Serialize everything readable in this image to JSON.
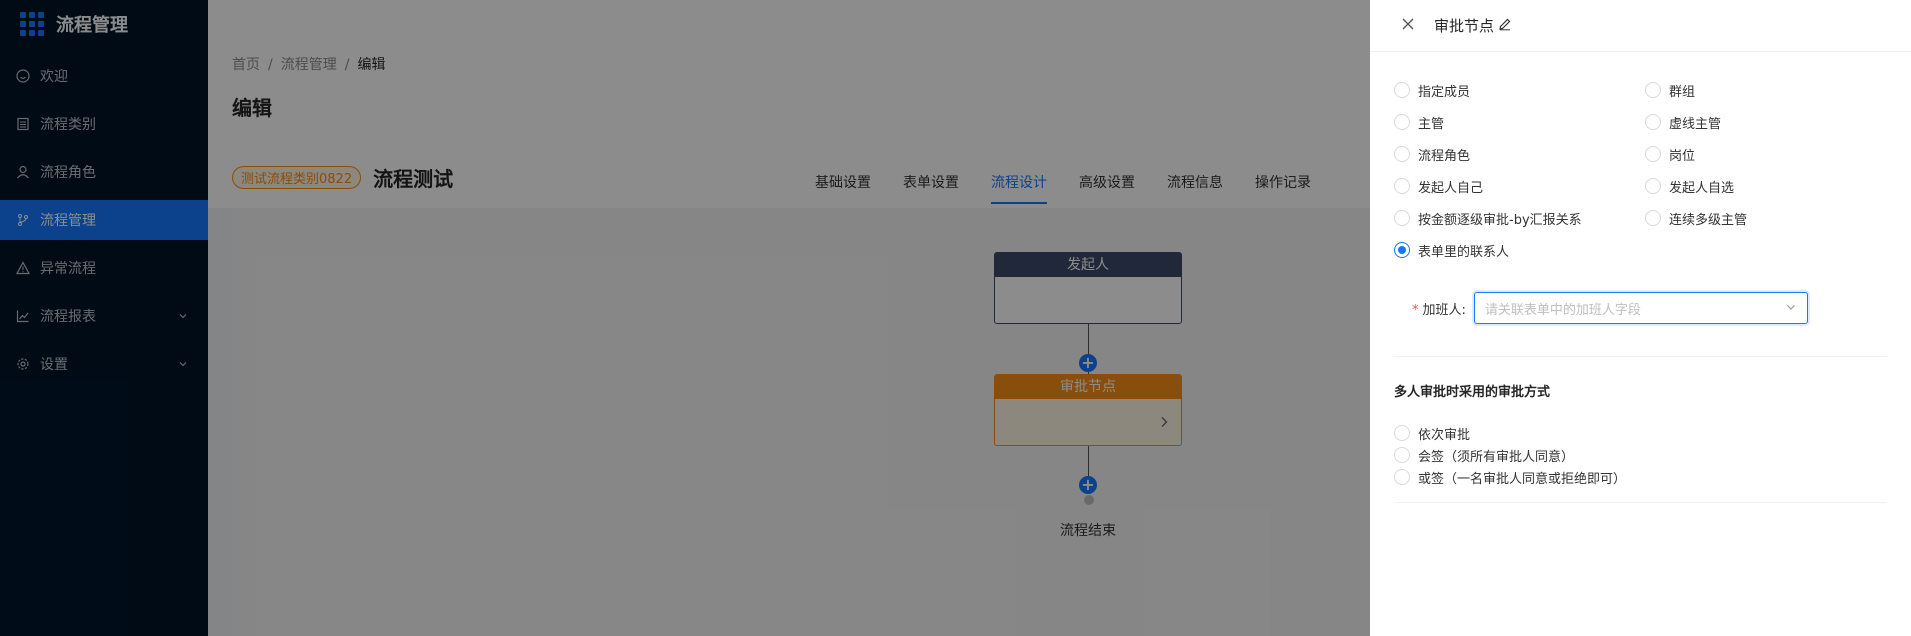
{
  "sidebar": {
    "title": "流程管理",
    "items": [
      {
        "label": "欢迎",
        "icon": "smile-icon",
        "active": false
      },
      {
        "label": "流程类别",
        "icon": "list-icon",
        "active": false
      },
      {
        "label": "流程角色",
        "icon": "user-icon",
        "active": false
      },
      {
        "label": "流程管理",
        "icon": "branch-icon",
        "active": true
      },
      {
        "label": "异常流程",
        "icon": "warning-icon",
        "active": false
      },
      {
        "label": "流程报表",
        "icon": "chart-icon",
        "active": false,
        "expandable": true
      },
      {
        "label": "设置",
        "icon": "gear-icon",
        "active": false,
        "expandable": true
      }
    ]
  },
  "header": {
    "breadcrumb": [
      "首页",
      "流程管理",
      "编辑"
    ],
    "title": "编辑"
  },
  "flow": {
    "category_tag": "测试流程类别0822",
    "name": "流程测试",
    "tabs": [
      {
        "label": "基础设置",
        "active": false
      },
      {
        "label": "表单设置",
        "active": false
      },
      {
        "label": "流程设计",
        "active": true
      },
      {
        "label": "高级设置",
        "active": false
      },
      {
        "label": "流程信息",
        "active": false
      },
      {
        "label": "操作记录",
        "active": false
      }
    ],
    "nodes": {
      "start_label": "发起人",
      "approve_label": "审批节点",
      "end_label": "流程结束"
    }
  },
  "drawer": {
    "title": "审批节点",
    "approver_types": [
      {
        "label": "指定成员",
        "checked": false
      },
      {
        "label": "群组",
        "checked": false
      },
      {
        "label": "主管",
        "checked": false
      },
      {
        "label": "虚线主管",
        "checked": false
      },
      {
        "label": "流程角色",
        "checked": false
      },
      {
        "label": "岗位",
        "checked": false
      },
      {
        "label": "发起人自己",
        "checked": false
      },
      {
        "label": "发起人自选",
        "checked": false
      },
      {
        "label": "按金额逐级审批-by汇报关系",
        "checked": false
      },
      {
        "label": "连续多级主管",
        "checked": false
      },
      {
        "label": "表单里的联系人",
        "checked": true
      }
    ],
    "field": {
      "label": "加班人:",
      "placeholder": "请关联表单中的加班人字段"
    },
    "multi_section_title": "多人审批时采用的审批方式",
    "multi_modes": [
      {
        "label": "依次审批",
        "checked": false
      },
      {
        "label": "会签（须所有审批人同意）",
        "checked": false
      },
      {
        "label": "或签（一名审批人同意或拒绝即可）",
        "checked": false
      }
    ]
  },
  "colors": {
    "primary": "#1677ff",
    "sidebar_bg": "#001529",
    "start_node": "#3b4a6b",
    "approve_node": "#fa8c16"
  }
}
